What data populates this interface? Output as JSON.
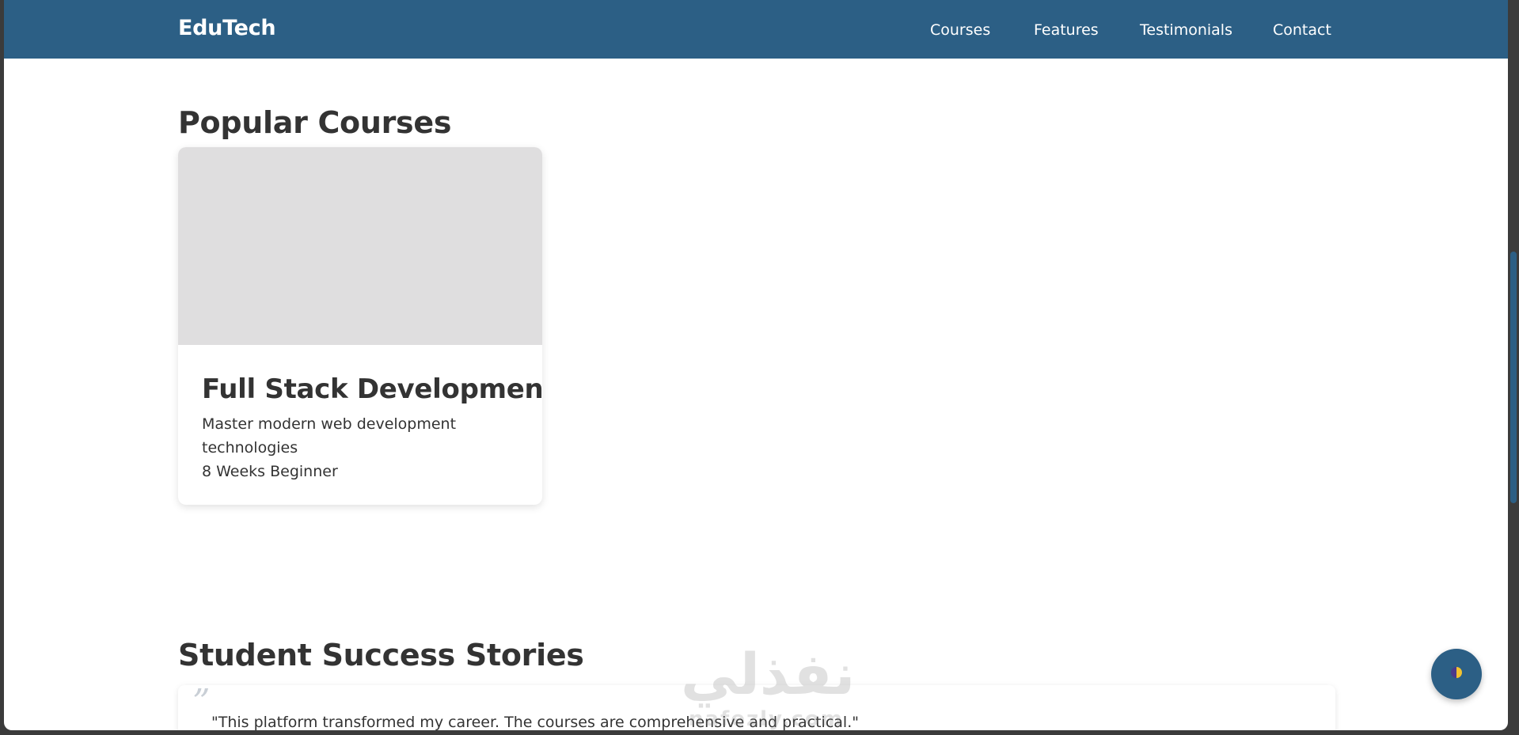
{
  "header": {
    "brand": "EduTech",
    "nav": [
      "Courses",
      "Features",
      "Testimonials",
      "Contact"
    ]
  },
  "courses": {
    "title": "Popular Courses",
    "items": [
      {
        "title": "Full Stack Development",
        "description": "Master modern web development technologies",
        "meta": "8 Weeks Beginner"
      }
    ]
  },
  "testimonials": {
    "title": "Student Success Stories",
    "quote_mark": "”",
    "items": [
      {
        "text": "\"This platform transformed my career. The courses are comprehensive and practical.\""
      }
    ]
  },
  "watermark": {
    "arabic": "نفذلي",
    "latin": "nafezly.com"
  },
  "fab": {
    "icon": "theme-toggle-icon"
  },
  "colors": {
    "primary": "#2c5f85",
    "text": "#333333",
    "card_image": "#dfdedf",
    "background": "#ffffff"
  }
}
